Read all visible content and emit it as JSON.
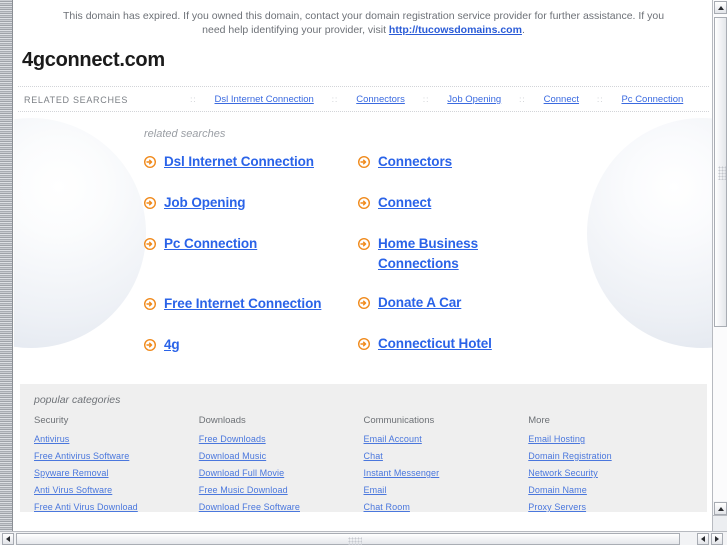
{
  "notice": {
    "text_before": "This domain has expired. If you owned this domain, contact your domain registration service provider for further assistance. If you need help identifying your provider, visit ",
    "link_text": "http://tucowsdomains.com",
    "text_after": "."
  },
  "domain": {
    "name": "4gconnect.com"
  },
  "related_strip": {
    "label": "RELATED SEARCHES",
    "separator": "::",
    "links": [
      "Dsl Internet Connection",
      "Connectors",
      "Job Opening",
      "Connect",
      "Pc Connection"
    ]
  },
  "related_searches": {
    "heading": "related searches",
    "left_column": [
      "Dsl Internet Connection",
      "Job Opening",
      "Pc Connection",
      "Free Internet Connection",
      "4g"
    ],
    "right_column": [
      "Connectors",
      "Connect",
      "Home Business Connections",
      "Donate A Car",
      "Connecticut Hotel"
    ]
  },
  "popular_categories": {
    "heading": "popular categories",
    "columns": [
      {
        "title": "Security",
        "links": [
          "Antivirus",
          "Free Antivirus Software",
          "Spyware Removal",
          "Anti Virus Software",
          "Free Anti Virus Download"
        ]
      },
      {
        "title": "Downloads",
        "links": [
          "Free Downloads",
          "Download Music",
          "Download Full Movie",
          "Free Music Download",
          "Download Free Software"
        ]
      },
      {
        "title": "Communications",
        "links": [
          "Email Account",
          "Chat",
          "Instant Messenger",
          "Email",
          "Chat Room"
        ]
      },
      {
        "title": "More",
        "links": [
          "Email Hosting",
          "Domain Registration",
          "Network Security",
          "Domain Name",
          "Proxy Servers"
        ]
      }
    ]
  },
  "colors": {
    "link_blue": "#2a63e8",
    "small_link_blue": "#4a77dd",
    "arrow_orange": "#f08a1c",
    "categories_bg": "#efefef",
    "notice_gray": "#6d7177"
  }
}
